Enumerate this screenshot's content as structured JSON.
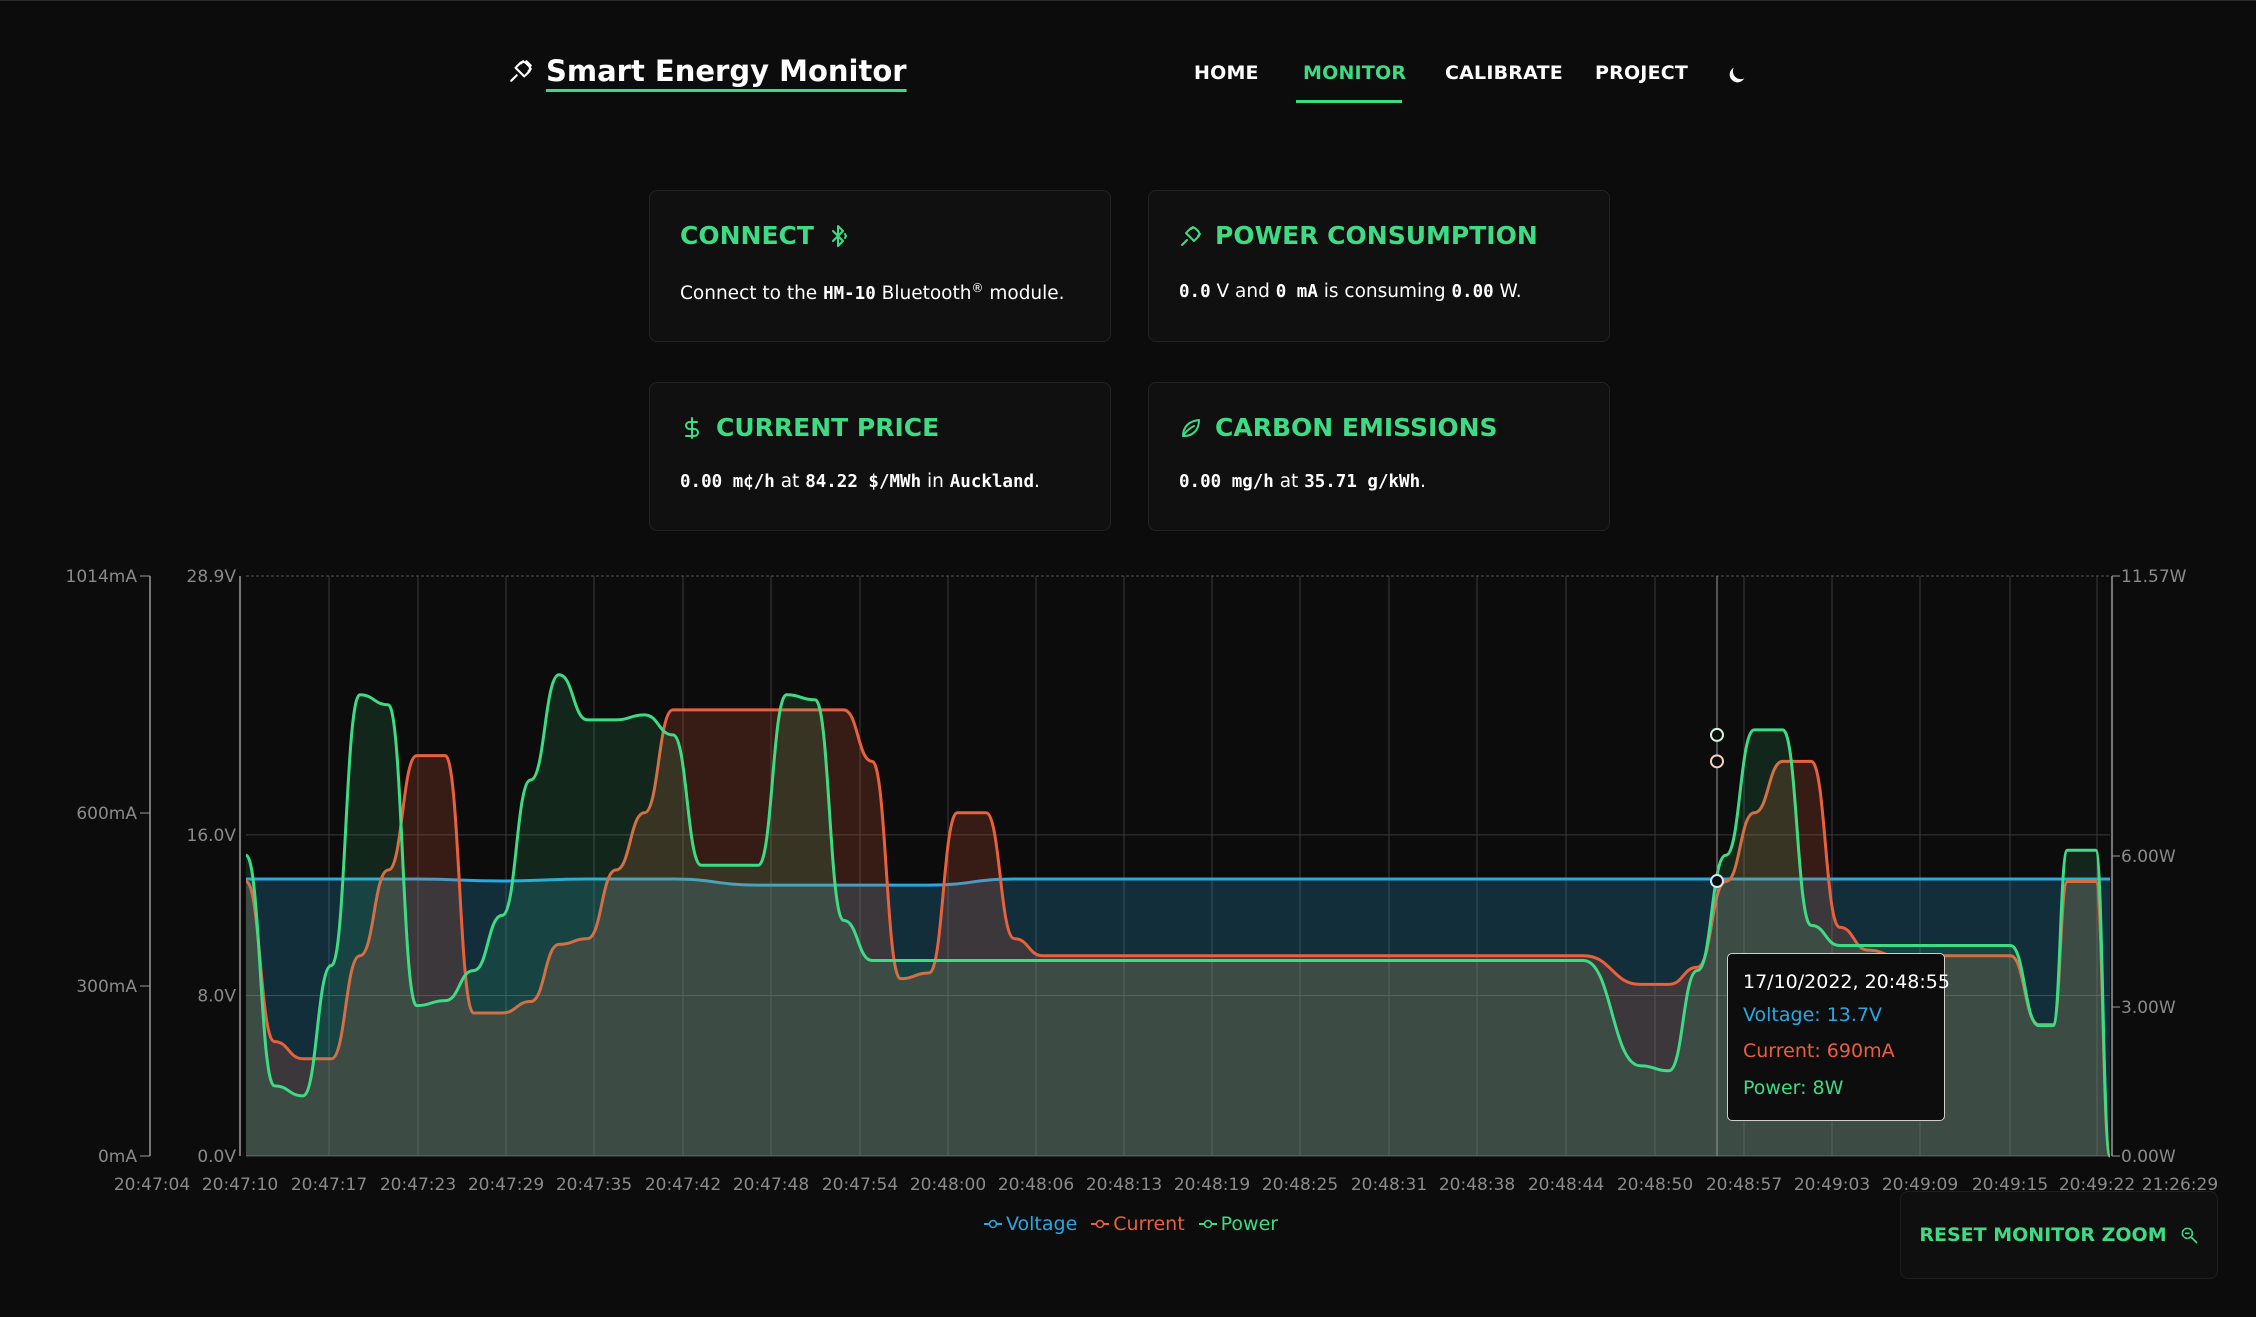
{
  "header": {
    "title": "Smart Energy Monitor",
    "icon": "plug-icon",
    "nav": [
      "HOME",
      "MONITOR",
      "CALIBRATE",
      "PROJECT"
    ],
    "active_nav": "MONITOR",
    "theme_icon": "moon-icon"
  },
  "cards": {
    "connect": {
      "title": "CONNECT",
      "icon": "bluetooth-icon",
      "text_pre": "Connect to the ",
      "module": "HM-10",
      "text_mid": " Bluetooth",
      "reg": "®",
      "text_post": " module."
    },
    "power": {
      "title": "POWER CONSUMPTION",
      "icon": "plug-icon",
      "voltage": "0.0",
      "v_unit": " V and ",
      "current": "0",
      "c_unit": " mA",
      "mid": " is consuming ",
      "power": "0.00",
      "p_unit": " W."
    },
    "price": {
      "title": "CURRENT PRICE",
      "icon": "dollar-icon",
      "value": "0.00",
      "unit": " m¢/h",
      "at": " at ",
      "rate": "84.22",
      "rate_unit": " $/MWh",
      "in": " in ",
      "location": "Auckland",
      "end": "."
    },
    "carbon": {
      "title": "CARBON EMISSIONS",
      "icon": "leaf-icon",
      "value": "0.00",
      "unit": " mg/h",
      "at": " at ",
      "rate": "35.71",
      "rate_unit": " g/kWh",
      "end": "."
    }
  },
  "tooltip": {
    "date": "17/10/2022, 20:48:55",
    "voltage": "Voltage: 13.7V",
    "current": "Current: 690mA",
    "power": "Power: 8W"
  },
  "legend": [
    "Voltage",
    "Current",
    "Power"
  ],
  "reset_button": {
    "label": "RESET MONITOR ZOOM",
    "icon": "zoom-reset-icon"
  },
  "colors": {
    "accent": "#3ddc84",
    "voltage": "#29a8e0",
    "current": "#e8603c",
    "power": "#3ddc84",
    "background": "#0c0c0c"
  },
  "chart_data": {
    "type": "line",
    "x": [
      "20:47:04",
      "20:47:10",
      "20:47:17",
      "20:47:23",
      "20:47:29",
      "20:47:35",
      "20:47:42",
      "20:47:48",
      "20:47:54",
      "20:48:00",
      "20:48:06",
      "20:48:13",
      "20:48:19",
      "20:48:25",
      "20:48:31",
      "20:48:38",
      "20:48:44",
      "20:48:50",
      "20:48:57",
      "20:49:03",
      "20:49:09",
      "20:49:15",
      "20:49:22",
      "21:26:29"
    ],
    "left_axis_current": {
      "ticks": [
        "1014mA",
        "600mA",
        "300mA",
        "0mA"
      ],
      "ylim": [
        0,
        1014
      ]
    },
    "left_axis_voltage": {
      "ticks": [
        "28.9V",
        "16.0V",
        "8.0V",
        "0.0V"
      ],
      "ylim": [
        0,
        28.9
      ]
    },
    "right_axis_power": {
      "ticks": [
        "11.57W",
        "6.00W",
        "3.00W",
        "0.00W"
      ],
      "ylim": [
        0,
        11.57
      ]
    },
    "series": [
      {
        "name": "Voltage",
        "unit": "V",
        "times_s": [
          6,
          12,
          18,
          24,
          30,
          36,
          42,
          48,
          54,
          60,
          66,
          72,
          78,
          84,
          90,
          96,
          102,
          108,
          114,
          120,
          126,
          132,
          137
        ],
        "values": [
          13.8,
          13.8,
          13.8,
          13.7,
          13.8,
          13.8,
          13.5,
          13.5,
          13.5,
          13.8,
          13.8,
          13.8,
          13.8,
          13.8,
          13.8,
          13.8,
          13.8,
          13.8,
          13.8,
          13.8,
          13.8,
          13.8,
          13.8
        ]
      },
      {
        "name": "Current",
        "unit": "mA",
        "times_s": [
          6,
          8,
          10,
          12,
          14,
          16,
          18,
          20,
          22,
          24,
          26,
          28,
          30,
          32,
          34,
          36,
          38,
          40,
          42,
          44,
          46,
          48,
          50,
          52,
          54,
          56,
          58,
          60,
          62,
          64,
          66,
          68,
          70,
          72,
          80,
          90,
          100,
          104,
          106,
          108,
          110,
          112,
          114,
          116,
          118,
          120,
          122,
          124,
          126,
          128,
          130,
          132,
          133,
          134,
          136,
          137
        ],
        "values": [
          480,
          200,
          170,
          170,
          350,
          500,
          700,
          700,
          250,
          250,
          270,
          370,
          380,
          500,
          600,
          780,
          780,
          780,
          780,
          780,
          780,
          780,
          690,
          310,
          320,
          600,
          600,
          380,
          350,
          350,
          350,
          350,
          350,
          350,
          350,
          350,
          350,
          300,
          300,
          330,
          480,
          600,
          690,
          690,
          400,
          360,
          350,
          350,
          350,
          350,
          350,
          230,
          230,
          480,
          480,
          0
        ]
      },
      {
        "name": "Power",
        "unit": "W",
        "times_s": [
          6,
          8,
          10,
          12,
          14,
          16,
          18,
          20,
          22,
          24,
          26,
          28,
          30,
          32,
          34,
          36,
          38,
          40,
          42,
          44,
          46,
          48,
          50,
          52,
          54,
          56,
          58,
          60,
          62,
          64,
          66,
          68,
          70,
          72,
          80,
          90,
          100,
          104,
          106,
          108,
          110,
          112,
          114,
          116,
          118,
          120,
          122,
          124,
          126,
          128,
          130,
          132,
          133,
          134,
          136,
          137
        ],
        "values": [
          6.0,
          1.4,
          1.2,
          3.8,
          9.2,
          9.0,
          3.0,
          3.1,
          3.7,
          4.8,
          7.5,
          9.6,
          8.7,
          8.7,
          8.8,
          8.4,
          5.8,
          5.8,
          5.8,
          9.2,
          9.1,
          4.7,
          3.9,
          3.9,
          3.9,
          3.9,
          3.9,
          3.9,
          3.9,
          3.9,
          3.9,
          3.9,
          3.9,
          3.9,
          3.9,
          3.9,
          3.9,
          1.8,
          1.7,
          3.7,
          6.0,
          8.5,
          8.5,
          4.6,
          4.2,
          4.2,
          4.2,
          4.2,
          4.2,
          4.2,
          4.2,
          2.6,
          2.6,
          6.1,
          6.1,
          0.0
        ]
      }
    ]
  }
}
